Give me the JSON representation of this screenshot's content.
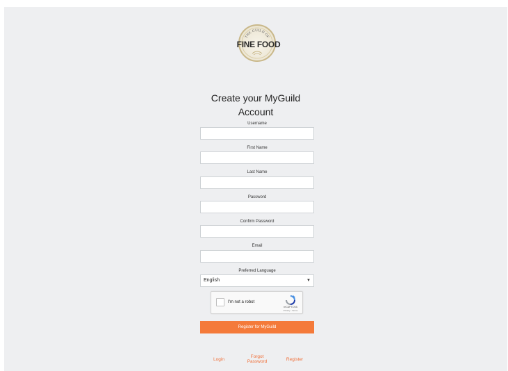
{
  "logo": {
    "arc_text": "THE GUILD OF",
    "main_text": "FINE FOOD"
  },
  "title": {
    "line1": "Create your MyGuild",
    "line2": "Account"
  },
  "fields": [
    {
      "label": "Username",
      "value": ""
    },
    {
      "label": "First Name",
      "value": ""
    },
    {
      "label": "Last Name",
      "value": ""
    },
    {
      "label": "Password",
      "value": ""
    },
    {
      "label": "Confirm Password",
      "value": ""
    },
    {
      "label": "Email",
      "value": ""
    }
  ],
  "language": {
    "label": "Preferred Language",
    "selected": "English"
  },
  "captcha": {
    "label": "I'm not a robot",
    "brand": "reCAPTCHA",
    "terms": "Privacy - Terms"
  },
  "register_button": "Register for MyGuild",
  "footer": {
    "login": "Login",
    "forgot_line1": "Forgot",
    "forgot_line2": "Password",
    "register": "Register"
  },
  "colors": {
    "accent": "#f47a3a",
    "link": "#f0703a",
    "background": "#eeeff1",
    "logo_gold": "#c9b88a"
  },
  "icons": [
    "guild-logo-icon",
    "checkbox-icon",
    "recaptcha-icon",
    "chevron-down-icon"
  ]
}
